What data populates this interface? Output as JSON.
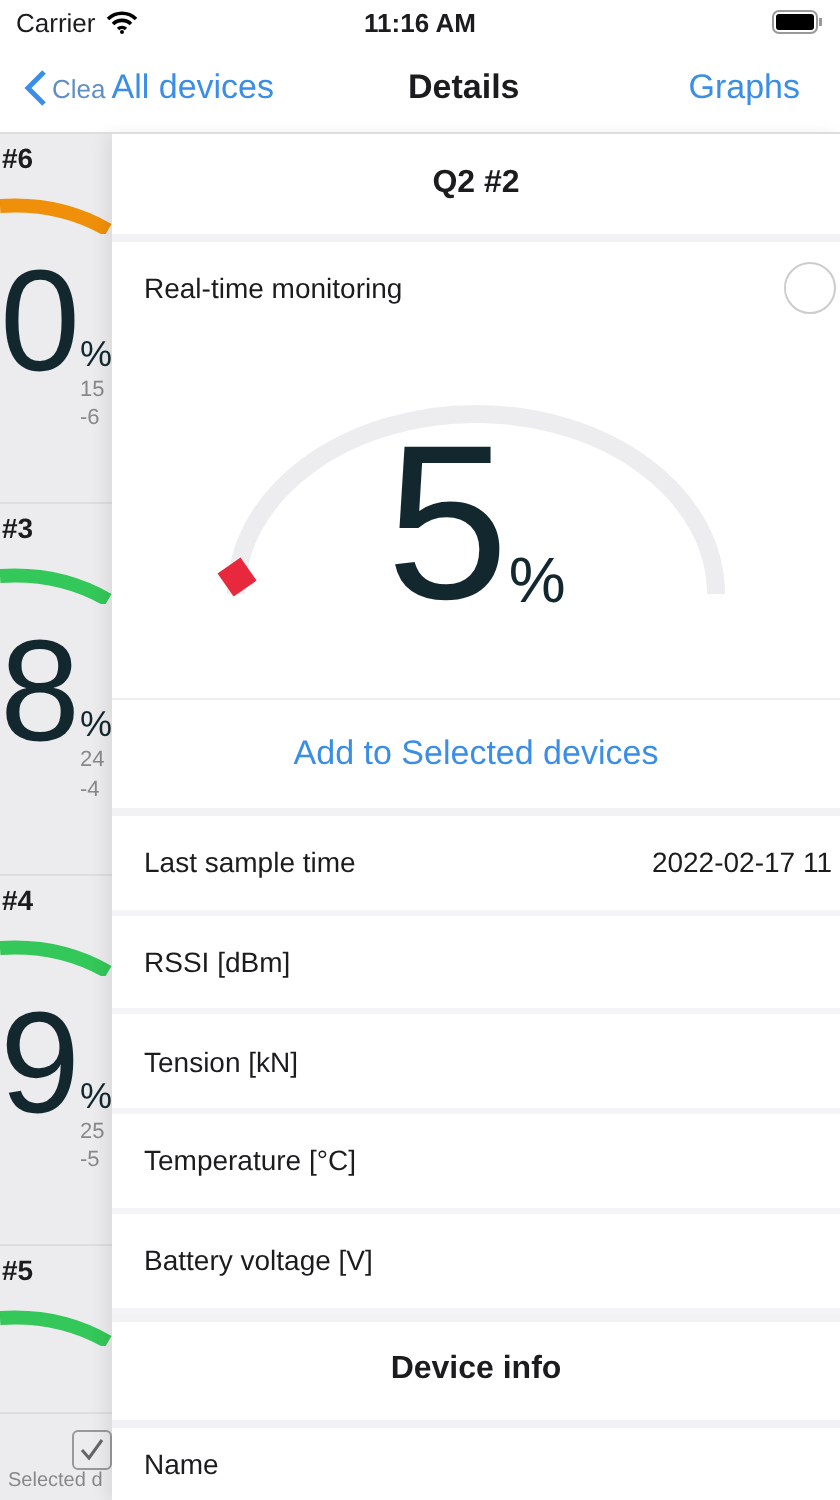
{
  "status_bar": {
    "carrier": "Carrier",
    "time": "11:16 AM"
  },
  "nav": {
    "back_faded": "Clea",
    "back": "All devices",
    "title": "Details",
    "action": "Graphs"
  },
  "device_list": {
    "cards": [
      {
        "name": "#6",
        "value": "0",
        "unit": "%",
        "line_1": "15",
        "line_2": "-6",
        "color": "#f0900a"
      },
      {
        "name": "#3",
        "value": "8",
        "unit": "%",
        "line_1": "24",
        "line_2": "-4",
        "color": "#34c759"
      },
      {
        "name": "#4",
        "value": "9",
        "unit": "%",
        "line_1": "25",
        "line_2": "-5",
        "color": "#34c759"
      },
      {
        "name": "#5",
        "color": "#34c759"
      }
    ],
    "footer": {
      "label": "Selected d",
      "checked": true
    }
  },
  "details": {
    "header": "Q2 #2",
    "monitoring": {
      "label": "Real-time monitoring",
      "on": false,
      "value": "5",
      "unit": "%",
      "level": 0.03
    },
    "add_link": "Add to Selected devices",
    "rows": [
      {
        "label": "Last sample time",
        "value": "2022-02-17 11"
      },
      {
        "label": "RSSI [dBm]"
      },
      {
        "label": "Tension [kN]"
      },
      {
        "label": "Temperature [°C]"
      },
      {
        "label": "Battery voltage [V]"
      }
    ],
    "section": "Device info",
    "info_rows": [
      {
        "label": "Name"
      }
    ]
  }
}
